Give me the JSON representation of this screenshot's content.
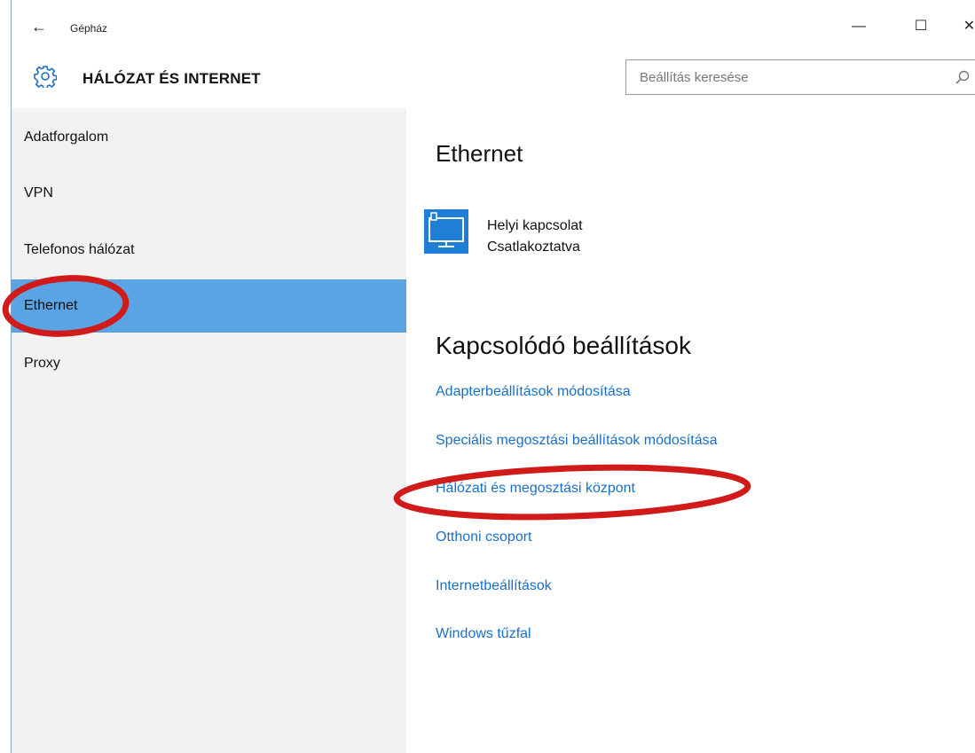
{
  "window": {
    "app_title": "Gépház",
    "controls": {
      "back": "←",
      "minimize": "—",
      "maximize": "☐",
      "close": "✕"
    }
  },
  "header": {
    "section_title": "HÁLÓZAT ÉS INTERNET",
    "icon": "gear-icon",
    "search": {
      "placeholder": "Beállítás keresése",
      "value": "",
      "icon": "search-icon"
    }
  },
  "sidebar": {
    "items": [
      {
        "label": "Adatforgalom",
        "selected": false
      },
      {
        "label": "VPN",
        "selected": false
      },
      {
        "label": "Telefonos hálózat",
        "selected": false
      },
      {
        "label": "Ethernet",
        "selected": true
      },
      {
        "label": "Proxy",
        "selected": false
      }
    ]
  },
  "main": {
    "title": "Ethernet",
    "connection": {
      "name": "Helyi kapcsolat",
      "status": "Csatlakoztatva",
      "icon": "monitor-network-icon"
    },
    "related_title": "Kapcsolódó beállítások",
    "links": [
      "Adapterbeállítások módosítása",
      "Speciális megosztási beállítások módosítása",
      "Hálózati és megosztási központ",
      "Otthoni csoport",
      "Internetbeállítások",
      "Windows tűzfal"
    ]
  },
  "colors": {
    "accent": "#5ba4e3",
    "link": "#1a6fc7",
    "sidebar_bg": "#f2f2f2",
    "annotation": "#d11a1a"
  }
}
